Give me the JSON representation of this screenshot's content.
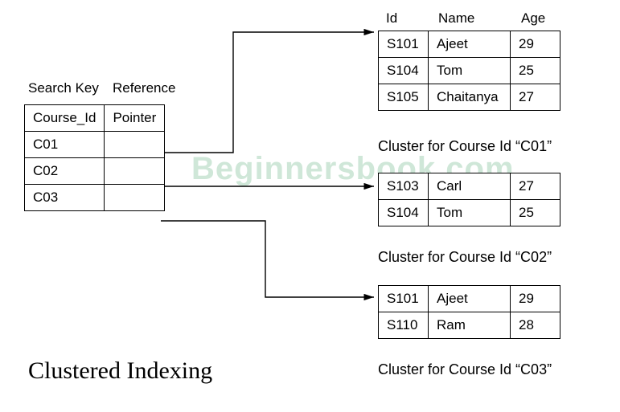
{
  "watermark": "Beginnersbook.com",
  "index": {
    "header_labels": {
      "search_key": "Search Key",
      "reference": "Reference"
    },
    "cols": {
      "course_id": "Course_Id",
      "pointer": "Pointer"
    },
    "rows": [
      {
        "course_id": "C01",
        "pointer": ""
      },
      {
        "course_id": "C02",
        "pointer": ""
      },
      {
        "course_id": "C03",
        "pointer": ""
      }
    ]
  },
  "cluster_headers": {
    "id": "Id",
    "name": "Name",
    "age": "Age"
  },
  "clusters": [
    {
      "caption": "Cluster for Course Id “C01”",
      "rows": [
        {
          "id": "S101",
          "name": "Ajeet",
          "age": "29"
        },
        {
          "id": "S104",
          "name": "Tom",
          "age": "25"
        },
        {
          "id": "S105",
          "name": "Chaitanya",
          "age": "27"
        }
      ]
    },
    {
      "caption": "Cluster for Course Id “C02”",
      "rows": [
        {
          "id": "S103",
          "name": "Carl",
          "age": "27"
        },
        {
          "id": "S104",
          "name": "Tom",
          "age": "25"
        }
      ]
    },
    {
      "caption": "Cluster for Course Id “C03”",
      "rows": [
        {
          "id": "S101",
          "name": "Ajeet",
          "age": "29"
        },
        {
          "id": "S110",
          "name": "Ram",
          "age": "28"
        }
      ]
    }
  ],
  "title": "Clustered Indexing"
}
